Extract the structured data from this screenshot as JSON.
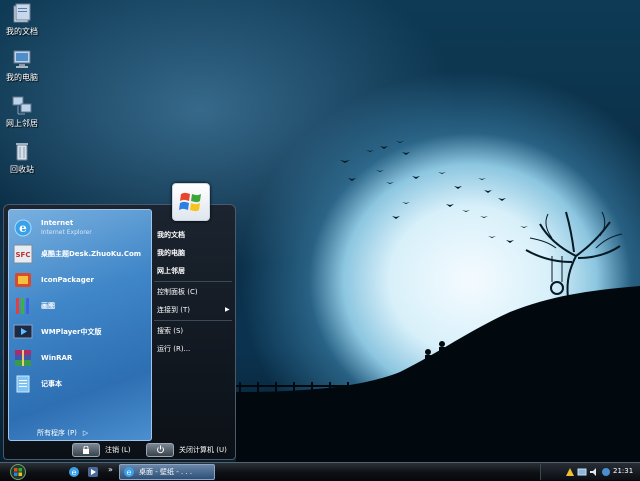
{
  "desktop": {
    "icons": [
      {
        "label": "我的文档",
        "icon": "my-documents-icon"
      },
      {
        "label": "我的电脑",
        "icon": "my-computer-icon"
      },
      {
        "label": "网上邻居",
        "icon": "network-places-icon"
      },
      {
        "label": "回收站",
        "icon": "recycle-bin-icon"
      }
    ]
  },
  "start_menu": {
    "programs": [
      {
        "name": "Internet",
        "sub": "Internet Explorer",
        "icon": "internet-explorer-icon"
      },
      {
        "name": "桌酷主题Desk.ZhuoKu.Com",
        "sub": "",
        "icon": "zhuoku-icon"
      },
      {
        "name": "IconPackager",
        "sub": "",
        "icon": "iconpackager-icon"
      },
      {
        "name": "画图",
        "sub": "",
        "icon": "paint-icon"
      },
      {
        "name": "WMPlayer中文版",
        "sub": "",
        "icon": "wmplayer-icon"
      },
      {
        "name": "WinRAR",
        "sub": "",
        "icon": "winrar-icon"
      },
      {
        "name": "记事本",
        "sub": "",
        "icon": "notepad-icon"
      }
    ],
    "all_programs": "所有程序 (P)",
    "right": {
      "my_documents": "我的文档",
      "my_computer": "我的电脑",
      "network": "网上邻居",
      "control_panel": "控制面板 (C)",
      "connect_to": "连接到 (T)",
      "search": "搜索 (S)",
      "run": "运行 (R)..."
    },
    "logoff": "注销 (L)",
    "shutdown": "关闭计算机 (U)"
  },
  "taskbar": {
    "task_label": "桌面 - 壁纸 - . . .",
    "clock": "21:31"
  },
  "colors": {
    "menu_left_pane": "#3f86c8",
    "taskbar": "#0d1014"
  }
}
